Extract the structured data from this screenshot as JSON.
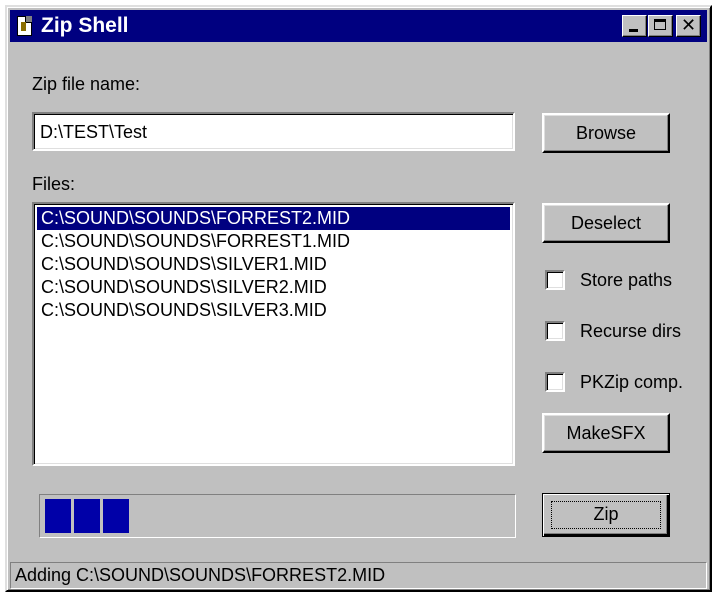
{
  "window": {
    "title": "Zip Shell",
    "buttons": {
      "minimize_icon": "minimize-icon",
      "maximize_icon": "maximize-icon",
      "close_icon": "close-icon",
      "close_glyph": "✕"
    },
    "app_icon": "document-icon"
  },
  "zip_file": {
    "label": "Zip file name:",
    "value": "D:\\TEST\\Test",
    "browse_label": "Browse"
  },
  "files": {
    "label": "Files:",
    "items": [
      "C:\\SOUND\\SOUNDS\\FORREST2.MID",
      "C:\\SOUND\\SOUNDS\\FORREST1.MID",
      "C:\\SOUND\\SOUNDS\\SILVER1.MID",
      "C:\\SOUND\\SOUNDS\\SILVER2.MID",
      "C:\\SOUND\\SOUNDS\\SILVER3.MID"
    ],
    "selected_index": 0
  },
  "actions": {
    "deselect_label": "Deselect",
    "makesfx_label": "MakeSFX",
    "zip_label": "Zip"
  },
  "options": [
    {
      "label": "Store paths",
      "checked": false
    },
    {
      "label": "Recurse dirs",
      "checked": false
    },
    {
      "label": "PKZip comp.",
      "checked": false
    }
  ],
  "progress": {
    "filled_blocks": 3,
    "fraction": 0.18
  },
  "status": {
    "text": "Adding C:\\SOUND\\SOUNDS\\FORREST2.MID"
  },
  "colors": {
    "title_bar": "#000080",
    "face": "#c0c0c0",
    "selection": "#000080",
    "progress": "#0000a8"
  }
}
